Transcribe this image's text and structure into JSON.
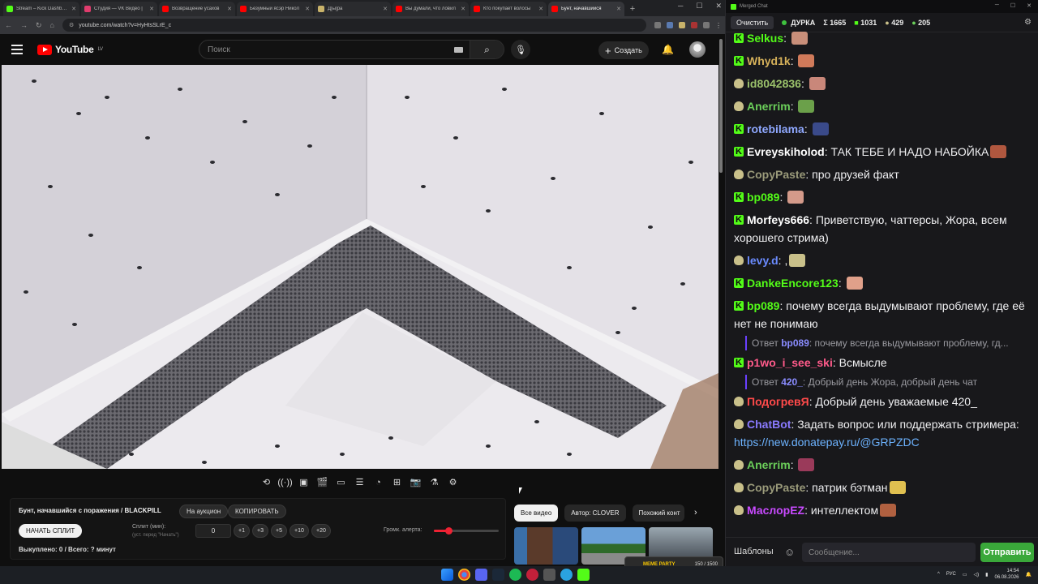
{
  "browser": {
    "tabs": [
      {
        "title": "Stream – Kick Dashboard",
        "color": "#53fc18",
        "active": false
      },
      {
        "title": "Студия — VK Видео |",
        "color": "#e03c6d",
        "active": false
      },
      {
        "title": "Возвращение усахов",
        "color": "#ff0000",
        "active": false
      },
      {
        "title": "Безумный ясэр Никол",
        "color": "#ff0000",
        "active": false
      },
      {
        "title": "Д[ы]ра",
        "color": "#c9b36a",
        "active": false
      },
      {
        "title": "Вы думали, что ловил",
        "color": "#ff0000",
        "active": false
      },
      {
        "title": "Кто покупает волосы",
        "color": "#ff0000",
        "active": false
      },
      {
        "title": "Бунт, начавшийся",
        "color": "#ff0000",
        "active": true
      }
    ],
    "url": "youtube.com/watch?v=HyHtsSLrE_c"
  },
  "youtube": {
    "logo_text": "YouTube",
    "region": "LV",
    "search_placeholder": "Поиск",
    "create_label": "Создать"
  },
  "controls_icons": [
    "repeat-icon",
    "broadcast-icon",
    "record-icon",
    "clip-icon",
    "frame-icon",
    "chapters-icon",
    "speed-icon",
    "add-icon",
    "screenshot-icon",
    "lab-icon",
    "settings-icon"
  ],
  "panel": {
    "title": "Бунт, начавшийся с поражения / BLACKPILL",
    "auction_label": "На аукцион",
    "copy_label": "КОПИРОВАТЬ",
    "start_split_label": "НАЧАТЬ СПЛИТ",
    "split_label": "Сплит (мин):",
    "split_sub": "(уст. перед \"Начать\")",
    "split_value": "0",
    "steps": [
      "+1",
      "+3",
      "+5",
      "+10",
      "+20"
    ],
    "volume_label": "Громк. алерта:",
    "volume_level": 0.22,
    "footer": "Выкуплено: 0 / Всего: ? минут"
  },
  "chips": [
    "Все видео",
    "Автор: CLOVER",
    "Похожий конт"
  ],
  "chat": {
    "window_title": "Merged Chat",
    "clear_label": "Очистить",
    "channel": "ДУРКА",
    "stats": [
      "Σ 1665",
      "1031",
      "429",
      "205"
    ],
    "messages": [
      {
        "badge": "k",
        "user": "Selkus",
        "color": "#53fc18",
        "text": "",
        "emote": "#c98f7a"
      },
      {
        "badge": "k",
        "user": "Whyd1k",
        "color": "#d6b15a",
        "text": "",
        "emote": "#d07a5a"
      },
      {
        "badge": "y",
        "user": "id8042836",
        "color": "#9bc26b",
        "text": "",
        "emote": "#c9877a"
      },
      {
        "badge": "y",
        "user": "Anerrim",
        "color": "#6bcf5a",
        "text": "",
        "emote": "#6ba04a"
      },
      {
        "badge": "k",
        "user": "rotebilama",
        "color": "#8fa8ff",
        "text": "",
        "emote": "#3a4a8a"
      },
      {
        "badge": "k",
        "user": "Evreyskiholod",
        "color": "#ffffff",
        "text": "ТАК ТЕБЕ И НАДО НАБОЙКА",
        "emote": "#b0573f"
      },
      {
        "badge": "y",
        "user": "CopyPaste",
        "color": "#9a9a7a",
        "text": "про друзей факт",
        "emote": ""
      },
      {
        "badge": "k",
        "user": "bp089",
        "color": "#53fc18",
        "text": "",
        "emote": "#d49a8a"
      },
      {
        "badge": "k",
        "user": "Morfeys666",
        "color": "#ffffff",
        "text": "Приветствую, чаттерсы, Жора, всем хорошего стрима)",
        "emote": ""
      },
      {
        "badge": "y",
        "user": "levy.d",
        "color": "#6a8bff",
        "text": ",",
        "emote": "#c9c08a"
      },
      {
        "badge": "k",
        "user": "DankeEncore123",
        "color": "#53fc18",
        "text": "",
        "emote": "#e0a08a"
      },
      {
        "badge": "k",
        "user": "bp089",
        "color": "#53fc18",
        "text": "почему всегда выдумывают проблему, где её нет не понимаю",
        "emote": ""
      },
      {
        "reply": true,
        "prefix": "Ответ",
        "user": "bp089",
        "text": "почему всегда выдумывают проблему, гд..."
      },
      {
        "badge": "k",
        "user": "p1wo_i_see_ski",
        "color": "#ff5a8a",
        "text": "Всмысле",
        "emote": ""
      },
      {
        "reply": true,
        "prefix": "Ответ",
        "user": "420_",
        "text": "Добрый день Жора, добрый день чат"
      },
      {
        "badge": "y",
        "user": "ПодогревЯ",
        "color": "#ff4a4a",
        "text": "Добрый день уважаемые 420_",
        "emote": ""
      },
      {
        "badge": "y",
        "user": "ChatBot",
        "color": "#8a7aff",
        "text": "Задать вопрос или поддержать стримера: ",
        "link": "https://new.donatepay.ru/@GRPZDC",
        "emote": ""
      },
      {
        "badge": "y",
        "user": "Anerrim",
        "color": "#6bcf5a",
        "text": "",
        "emote": "#9a3a5a"
      },
      {
        "badge": "y",
        "user": "CopyPaste",
        "color": "#9a9a7a",
        "text": "патрик бэтман",
        "emote": "#e0c050"
      },
      {
        "badge": "y",
        "user": "МаслорЕZ",
        "color": "#c84aff",
        "text": "интеллектом",
        "emote": "#b06040"
      }
    ],
    "templates_label": "Шаблоны",
    "input_placeholder": "Сообщение...",
    "send_label": "Отправить"
  },
  "meme_party": {
    "label": "MEME PARTY",
    "count": "150 / 1500"
  },
  "taskbar": {
    "lang": "РУС",
    "time": "14:54",
    "date": "06.08.2026"
  }
}
